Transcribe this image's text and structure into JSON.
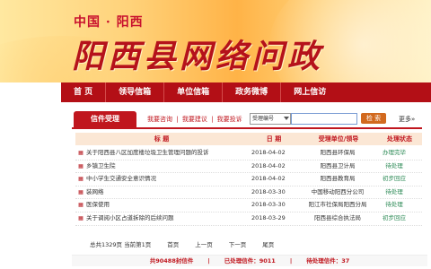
{
  "header": {
    "subtitle": "中国 · 阳西",
    "title": "阳西县网络问政"
  },
  "nav": {
    "items": [
      "首 页",
      "领导信箱",
      "单位信箱",
      "政务微博",
      "网上信访"
    ]
  },
  "toolbar": {
    "tab_label": "信件受理",
    "links": [
      "我要咨询",
      "|",
      "我要建议",
      "|",
      "我要投诉"
    ],
    "select_value": "受理编号",
    "search_button": "检 索",
    "more": "更多»"
  },
  "table": {
    "headers": [
      "标  题",
      "日 期",
      "受理单位/领导",
      "处理状态"
    ],
    "rows": [
      {
        "title": "关于阳西县八区加度楼垃圾卫生管理问题的投诉",
        "date": "2018-04-02",
        "unit": "阳西县环保局",
        "status": "办理完毕"
      },
      {
        "title": "乡镇卫生院",
        "date": "2018-04-02",
        "unit": "阳西县卫计局",
        "status": "待处理"
      },
      {
        "title": "中小学生交通安全意识情况",
        "date": "2018-04-02",
        "unit": "阳西县教育局",
        "status": "初步回应"
      },
      {
        "title": "装网络",
        "date": "2018-03-30",
        "unit": "中国移动阳西分公司",
        "status": "待处理"
      },
      {
        "title": "医保使用",
        "date": "2018-03-30",
        "unit": "阳江市社保局阳西分局",
        "status": "待处理"
      },
      {
        "title": "关于调阅小区占道拆除的后续问题",
        "date": "2018-03-29",
        "unit": "阳西县综合执法局",
        "status": "初步回应"
      }
    ]
  },
  "pager": {
    "summary": "总共1329页 当前第1页",
    "first": "首页",
    "prev": "上一页",
    "next": "下一页",
    "last": "尾页"
  },
  "stats": {
    "total": "共90488封信件",
    "processed": "已处理信件：9011",
    "pending": "待处理信件：37"
  },
  "colors": {
    "brand_red": "#b30f16",
    "status_green": "#2e8b57"
  }
}
